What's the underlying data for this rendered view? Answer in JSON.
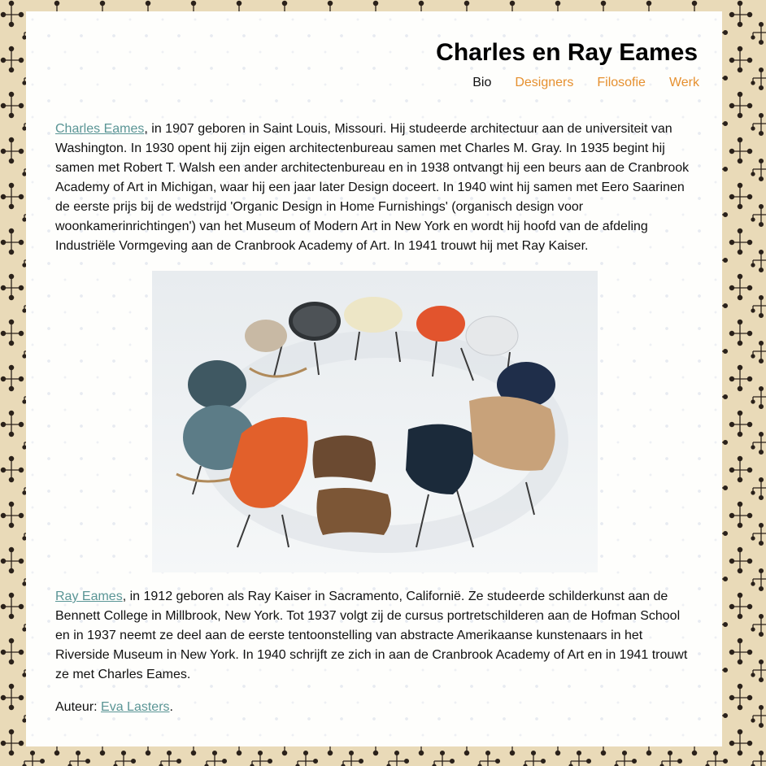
{
  "header": {
    "title": "Charles en Ray Eames"
  },
  "nav": {
    "items": [
      {
        "label": "Bio",
        "active": true
      },
      {
        "label": "Designers",
        "active": false
      },
      {
        "label": "Filosofie",
        "active": false
      },
      {
        "label": "Werk",
        "active": false
      }
    ]
  },
  "content": {
    "charles": {
      "link": "Charles Eames",
      "text": ", in 1907 geboren in Saint Louis, Missouri. Hij studeerde architectuur aan de universiteit van Washington. In 1930 opent hij zijn eigen architectenbureau samen met Charles M. Gray. In 1935 begint hij samen met Robert T. Walsh een ander architectenbureau en in 1938 ontvangt hij een beurs aan de Cranbrook Academy of Art in Michigan, waar hij een jaar later Design doceert. In 1940 wint hij samen met Eero Saarinen de eerste prijs bij de wedstrijd 'Organic Design in Home Furnishings' (organisch design voor woonkamerinrichtingen') van het Museum of Modern Art in New York en wordt hij hoofd van de afdeling Industriële Vormgeving aan de Cranbrook Academy of Art. In 1941 trouwt hij met Ray Kaiser."
    },
    "ray": {
      "link": "Ray Eames",
      "text": ", in 1912 geboren als Ray Kaiser in Sacramento, Californië. Ze studeerde schilderkunst aan de Bennett College in Millbrook, New York. Tot 1937 volgt zij de cursus portretschilderen aan de Hofman School en in 1937 neemt ze deel aan de eerste tentoonstelling van abstracte Amerikaanse kunstenaars in het Riverside Museum in New York. In 1940 schrijft ze zich in aan de Cranbrook Academy of Art en in 1941 trouwt ze met Charles Eames."
    },
    "author": {
      "label": "Auteur: ",
      "link": "Eva Lasters",
      "suffix": "."
    }
  },
  "colors": {
    "nav_link": "#e6902f",
    "text_link": "#5a9595",
    "page_background": "#e7d7b3"
  }
}
